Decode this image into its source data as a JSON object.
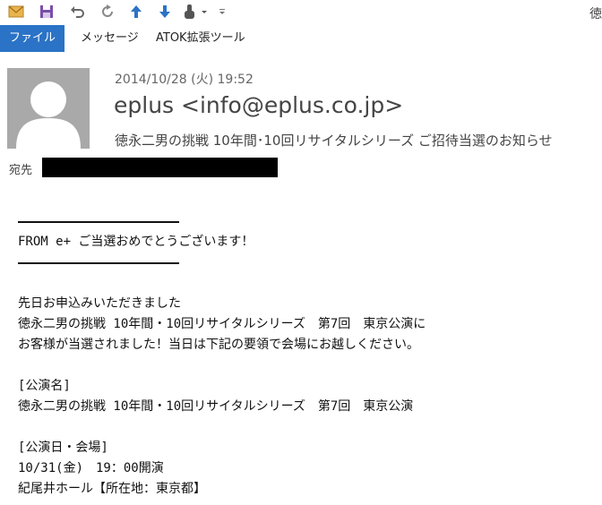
{
  "window": {
    "title_fragment": "徳"
  },
  "tabs": {
    "file": "ファイル",
    "message": "メッセージ",
    "atok": "ATOK拡張ツール"
  },
  "header": {
    "date": "2014/10/28 (火) 19:52",
    "sender": "eplus <info@eplus.co.jp>",
    "subject": "徳永二男の挑戦 10年間･10回リサイタルシリーズ ご招待当選のお知らせ",
    "to_label": "宛先"
  },
  "body": {
    "greeting": "FROM e+ ご当選おめでとうございます！",
    "p1_l1": "先日お申込みいただきました",
    "p1_l2": "徳永二男の挑戦 10年間・10回リサイタルシリーズ　第7回　東京公演に",
    "p1_l3": "お客様が当選されました！当日は下記の要領で会場にお越しください。",
    "sec1_title": "[公演名]",
    "sec1_value": "徳永二男の挑戦 10年間・10回リサイタルシリーズ　第7回　東京公演",
    "sec2_title": "[公演日・会場]",
    "sec2_date": "10/31(金)　19：00開演",
    "sec2_venue": "紀尾井ホール【所在地：東京都】"
  },
  "icons": [
    "mail-icon",
    "save-icon",
    "undo-icon",
    "redo-icon",
    "up-arrow-icon",
    "down-arrow-icon",
    "touch-mode-icon",
    "customize-icon"
  ],
  "colors": {
    "file_tab": "#2a73c6",
    "avatar_bg": "#a9a9a9"
  }
}
